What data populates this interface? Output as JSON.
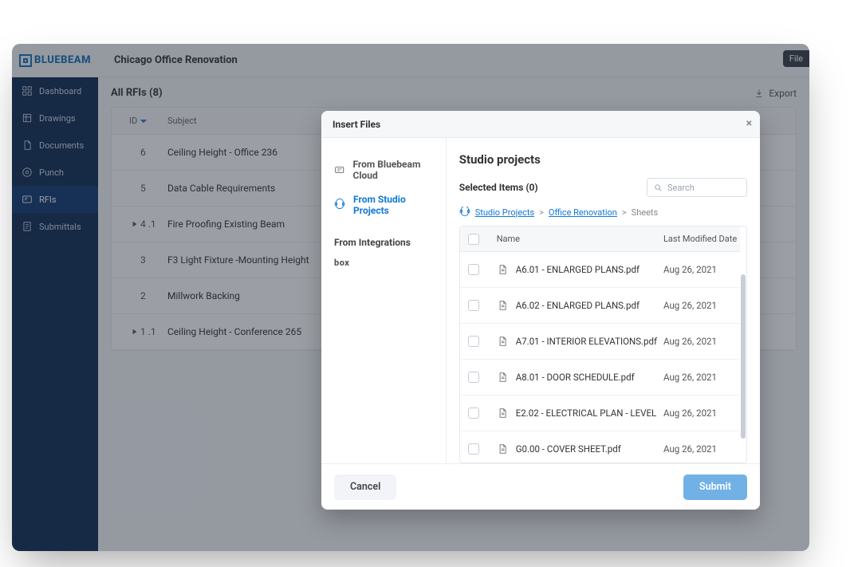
{
  "header": {
    "brand": "BLUEBEAM",
    "project": "Chicago Office Renovation",
    "file_chip": "File"
  },
  "sidebar": {
    "items": [
      {
        "label": "Dashboard"
      },
      {
        "label": "Drawings"
      },
      {
        "label": "Documents"
      },
      {
        "label": "Punch"
      },
      {
        "label": "RFIs"
      },
      {
        "label": "Submittals"
      }
    ],
    "active_index": 4
  },
  "list": {
    "title": "All RFIs (8)",
    "export_label": "Export",
    "columns": {
      "id": "ID",
      "subject": "Subject"
    },
    "rows": [
      {
        "id": "6",
        "subject": "Ceiling Height - Office 236",
        "expandable": false
      },
      {
        "id": "5",
        "subject": "Data Cable Requirements",
        "expandable": false
      },
      {
        "id": "4 .1",
        "subject": "Fire Proofing Existing Beam",
        "expandable": true
      },
      {
        "id": "3",
        "subject": "F3 Light Fixture -Mounting Height",
        "expandable": false
      },
      {
        "id": "2",
        "subject": "Millwork Backing",
        "expandable": false
      },
      {
        "id": "1 .1",
        "subject": "Ceiling Height - Conference 265",
        "expandable": true
      }
    ]
  },
  "modal": {
    "title": "Insert Files",
    "sources": {
      "bluebeam_cloud": "From Bluebeam Cloud",
      "studio_projects": "From Studio Projects",
      "integrations_label": "From Integrations",
      "box": "box"
    },
    "picker": {
      "title": "Studio projects",
      "selected_label": "Selected Items (0)",
      "search_placeholder": "Search",
      "breadcrumbs": {
        "root": "Studio Projects",
        "project": "Office Renovation",
        "folder": "Sheets"
      },
      "columns": {
        "name": "Name",
        "date": "Last Modified Date"
      },
      "files": [
        {
          "name": "A6.01 - ENLARGED PLANS.pdf",
          "date": "Aug 26, 2021"
        },
        {
          "name": "A6.02 - ENLARGED PLANS.pdf",
          "date": "Aug 26, 2021"
        },
        {
          "name": "A7.01 - INTERIOR ELEVATIONS.pdf",
          "date": "Aug 26, 2021"
        },
        {
          "name": "A8.01 - DOOR SCHEDULE.pdf",
          "date": "Aug 26, 2021"
        },
        {
          "name": "E2.02 - ELECTRICAL PLAN - LEVEL",
          "date": "Aug 26, 2021"
        },
        {
          "name": "G0.00 - COVER SHEET.pdf",
          "date": "Aug 26, 2021"
        }
      ]
    },
    "buttons": {
      "cancel": "Cancel",
      "submit": "Submit"
    }
  }
}
